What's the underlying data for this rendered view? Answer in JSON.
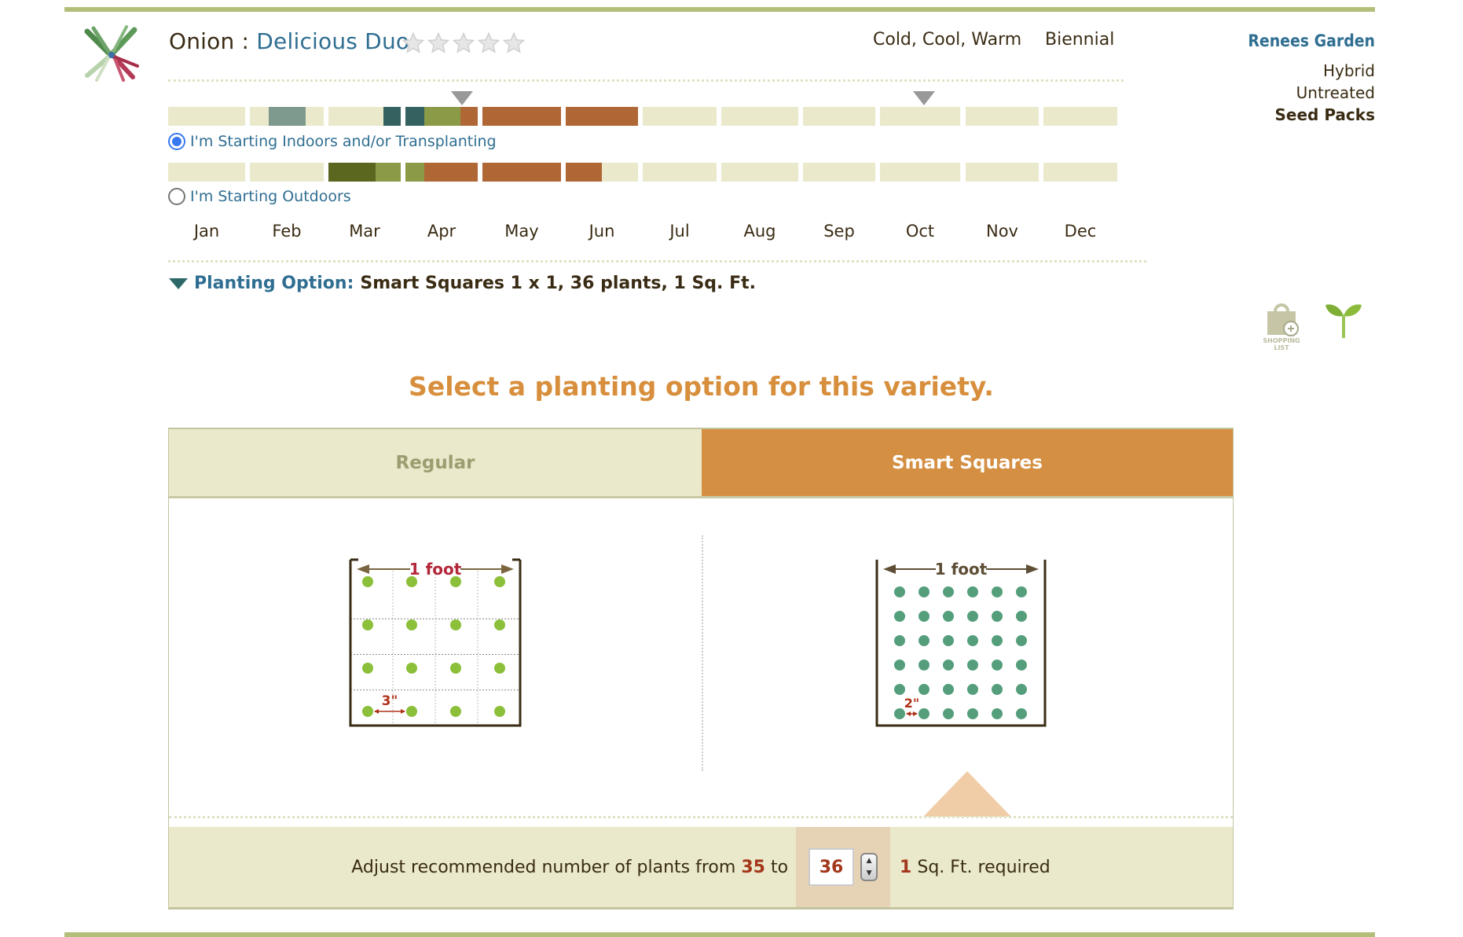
{
  "header": {
    "crop": "Onion",
    "separator": " : ",
    "variety": "Delicious Duo",
    "rating": {
      "value": 0,
      "max": 5
    },
    "temperature": "Cold, Cool, Warm",
    "lifecycle": "Biennial",
    "brand": "Renees Garden",
    "attributes": [
      "Hybrid",
      "Untreated",
      "Seed Packs"
    ]
  },
  "timeline": {
    "months": [
      "Jan",
      "Feb",
      "Mar",
      "Apr",
      "May",
      "Jun",
      "Jul",
      "Aug",
      "Sep",
      "Oct",
      "Nov",
      "Dec"
    ],
    "markers": [
      {
        "month": 3,
        "fraction": 0.78
      },
      {
        "month": 9,
        "fraction": 0.55
      }
    ],
    "colors": {
      "empty": "#ebe9cb",
      "grey_teal": "#7e998e",
      "dark_teal": "#336261",
      "olive": "#8a9a47",
      "dark_olive": "#5b661f",
      "harvest": "#b06736"
    },
    "rows": [
      {
        "label": "I'm Starting Indoors and/or Transplanting",
        "selected": true,
        "segments": [
          {
            "month": 1,
            "from": 0.25,
            "to": 0.75,
            "color": "grey_teal"
          },
          {
            "month": 2,
            "from": 0.76,
            "to": 1.0,
            "color": "dark_teal"
          },
          {
            "month": 3,
            "from": 0.0,
            "to": 0.26,
            "color": "dark_teal"
          },
          {
            "month": 3,
            "from": 0.26,
            "to": 0.76,
            "color": "olive"
          },
          {
            "month": 3,
            "from": 0.76,
            "to": 1.0,
            "color": "harvest"
          },
          {
            "month": 4,
            "from": 0.0,
            "to": 1.0,
            "color": "harvest"
          },
          {
            "month": 5,
            "from": 0.0,
            "to": 1.0,
            "color": "harvest"
          }
        ]
      },
      {
        "label": "I'm Starting Outdoors",
        "selected": false,
        "segments": [
          {
            "month": 2,
            "from": 0.0,
            "to": 0.65,
            "color": "dark_olive"
          },
          {
            "month": 2,
            "from": 0.65,
            "to": 1.0,
            "color": "olive"
          },
          {
            "month": 3,
            "from": 0.0,
            "to": 0.26,
            "color": "olive"
          },
          {
            "month": 3,
            "from": 0.26,
            "to": 1.0,
            "color": "harvest"
          },
          {
            "month": 4,
            "from": 0.0,
            "to": 1.0,
            "color": "harvest"
          },
          {
            "month": 5,
            "from": 0.0,
            "to": 0.5,
            "color": "harvest"
          }
        ]
      }
    ]
  },
  "planting_option": {
    "label": "Planting Option:",
    "value": "Smart Squares 1 x 1, 36 plants, 1 Sq. Ft."
  },
  "side_icons": {
    "shopping_list": "SHOPPING LIST",
    "sprout": "sprout-icon"
  },
  "selector": {
    "heading": "Select a planting option for this variety.",
    "tabs": [
      {
        "label": "Regular",
        "active": false
      },
      {
        "label": "Smart Squares",
        "active": true
      }
    ],
    "diagrams": {
      "regular": {
        "label": "1 foot",
        "spacing": "3\"",
        "grid": [
          4,
          4
        ]
      },
      "smart": {
        "label": "1 foot",
        "spacing": "2\"",
        "grid": [
          6,
          6
        ]
      }
    }
  },
  "adjust": {
    "prefix": "Adjust recommended number of plants from",
    "recommended": "35",
    "to": "to",
    "value": "36",
    "area": "1",
    "suffix": "Sq. Ft. required"
  }
}
